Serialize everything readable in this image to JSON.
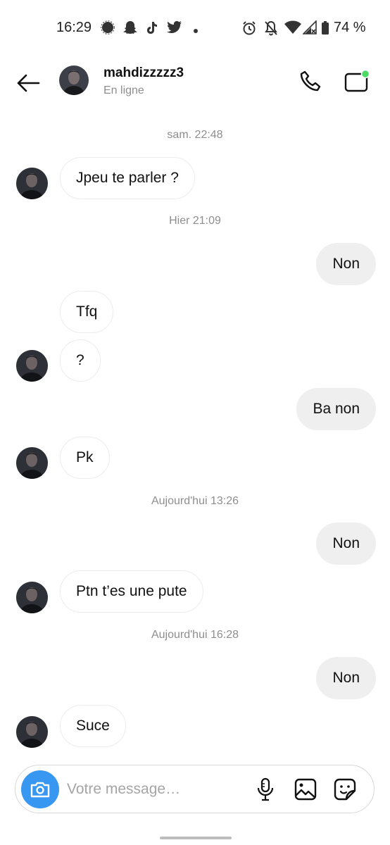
{
  "status_bar": {
    "time": "16:29",
    "battery": "74 %",
    "icons": [
      "signal-app-icon",
      "snapchat-icon",
      "tiktok-icon",
      "twitter-icon",
      "dot-icon",
      "alarm-icon",
      "bell-off-icon",
      "wifi-icon",
      "cell-signal-icon",
      "battery-icon"
    ]
  },
  "header": {
    "name": "mahdizzzzz3",
    "status": "En ligne",
    "online_color": "#4cd964"
  },
  "conversation": {
    "timestamps": [
      "sam. 22:48",
      "Hier 21:09",
      "Aujourd'hui 13:26",
      "Aujourd'hui 16:28"
    ],
    "messages": [
      {
        "from": "them",
        "text": "Jpeu te parler ?"
      },
      {
        "from": "me",
        "text": "Non"
      },
      {
        "from": "them",
        "text": "Tfq"
      },
      {
        "from": "them",
        "text": "?"
      },
      {
        "from": "me",
        "text": "Ba non"
      },
      {
        "from": "them",
        "text": "Pk"
      },
      {
        "from": "me",
        "text": "Non"
      },
      {
        "from": "them",
        "text": "Ptn t’es une pute"
      },
      {
        "from": "me",
        "text": "Non"
      },
      {
        "from": "them",
        "text": "Suce"
      }
    ]
  },
  "composer": {
    "placeholder": "Votre message…",
    "accent": "#3897f0"
  }
}
